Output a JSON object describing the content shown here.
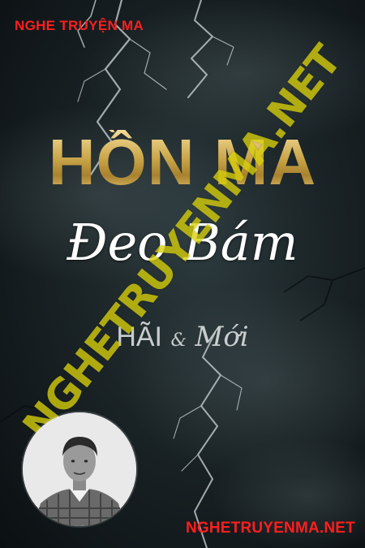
{
  "header": {
    "brand": "NGHE TRUYỆN MA"
  },
  "watermark": {
    "text": "NGHETRUYENMA.NET"
  },
  "book": {
    "title_line1": "HỒN MA",
    "title_line2": "Đeo Bám",
    "author_1": "HÃI",
    "author_separator": "&",
    "author_2": "Mới"
  },
  "footer": {
    "site": "NGHETRUYENMA.NET"
  },
  "avatar": {
    "icon": "person-portrait-icon"
  },
  "colors": {
    "brand_red": "#ff1e1e",
    "watermark_yellow": "#d8d00a",
    "title_gold": "#d6b75c",
    "background": "#0e1416"
  }
}
